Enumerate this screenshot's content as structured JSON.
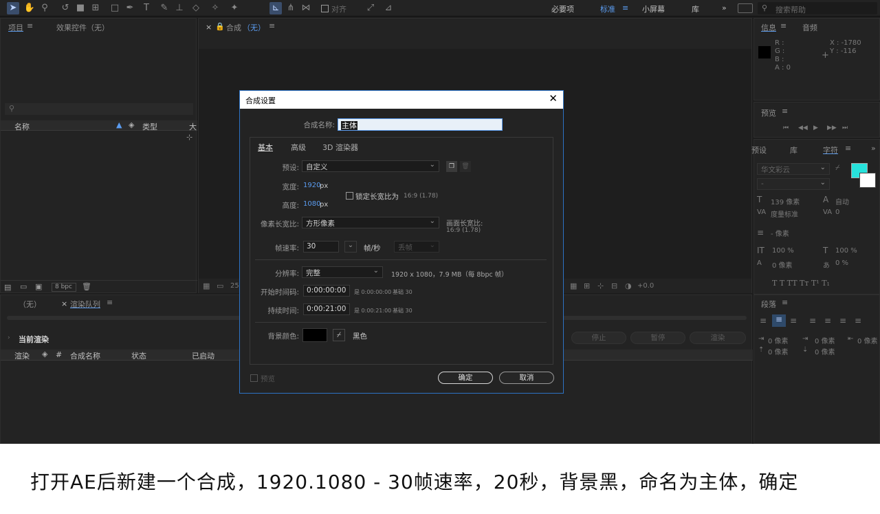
{
  "toolbar": {
    "workspaces": [
      "必要项",
      "标准",
      "小屏幕",
      "库"
    ],
    "active_workspace": "标准",
    "snap_label": "对齐",
    "search_placeholder": "搜索帮助"
  },
  "project_panel": {
    "tabs": [
      "项目",
      "效果控件（无）"
    ],
    "columns": [
      "名称",
      "类型",
      "大"
    ],
    "bpc": "8 bpc"
  },
  "comp_panel": {
    "tab_label": "合成",
    "tab_value": "（无）",
    "zoom": "25",
    "exposure": "+0.0"
  },
  "render_panel": {
    "tabs": [
      "（无）",
      "渲染队列"
    ],
    "current_render": "当前渲染",
    "columns": [
      "渲染",
      "#",
      "合成名称",
      "状态",
      "已启动"
    ],
    "buttons": [
      "停止",
      "暂停",
      "渲染"
    ]
  },
  "info_panel": {
    "tabs": [
      "信息",
      "音频"
    ],
    "r": "R :",
    "g": "G :",
    "b": "B :",
    "a": "A : 0",
    "x": "X : -1780",
    "y": "Y : -116"
  },
  "preview_panel": {
    "title": "预览"
  },
  "character_panel": {
    "tabs": [
      "预设",
      "库",
      "字符"
    ],
    "font": "华文彩云",
    "style": "-",
    "size": "139 像素",
    "leading": "自动",
    "kerning": "度量标准",
    "tracking": "0",
    "stroke": "- 像素",
    "vscale": "100 %",
    "hscale": "100 %",
    "baseline": "0 像素",
    "tsume": "0 %",
    "fill_color": "#27e3dc"
  },
  "paragraph_panel": {
    "title": "段落",
    "indents": [
      "0 像素",
      "0 像素",
      "0 像素",
      "0 像素",
      "0 像素"
    ]
  },
  "dialog": {
    "title": "合成设置",
    "name_label": "合成名称:",
    "name_value": "主体",
    "tabs": [
      "基本",
      "高级",
      "3D 渲染器"
    ],
    "preset_label": "预设:",
    "preset_value": "自定义",
    "width_label": "宽度:",
    "width_value": "1920",
    "height_label": "高度:",
    "height_value": "1080",
    "unit": "px",
    "lock_label": "锁定长宽比为",
    "lock_ratio": "16:9 (1.78)",
    "pixel_ratio_label": "像素长宽比:",
    "pixel_ratio_value": "方形像素",
    "frame_ratio_label": "画面长宽比:",
    "frame_ratio_value": "16:9 (1.78)",
    "fps_label": "帧速率:",
    "fps_value": "30",
    "fps_unit": "帧/秒",
    "drop_frame": "丢帧",
    "resolution_label": "分辨率:",
    "resolution_value": "完整",
    "resolution_info": "1920 x 1080，7.9 MB（每 8bpc 帧）",
    "start_label": "开始时间码:",
    "start_value": "0:00:00:00",
    "start_info": "是 0:00:00:00",
    "start_base": "基础 30",
    "duration_label": "持续时间:",
    "duration_value": "0:00:21:00",
    "duration_info": "是 0:00:21:00",
    "duration_base": "基础 30",
    "bg_label": "背景颜色:",
    "bg_name": "黑色",
    "bg_color": "#000000",
    "preview_label": "预览",
    "ok": "确定",
    "cancel": "取消"
  },
  "caption": "打开AE后新建一个合成，1920.1080 - 30帧速率，20秒，背景黑，命名为主体，确定"
}
